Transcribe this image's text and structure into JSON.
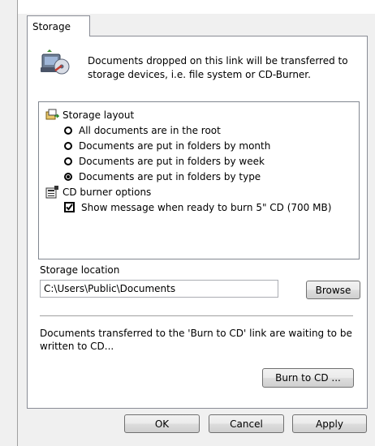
{
  "tab": {
    "label": "Storage"
  },
  "description": "Documents dropped on this link will be transferred to storage devices, i.e. file system or CD-Burner.",
  "options": {
    "storage_layout": {
      "title": "Storage layout",
      "items": [
        {
          "label": "All documents are in the root",
          "selected": false
        },
        {
          "label": "Documents are put in folders by month",
          "selected": false
        },
        {
          "label": "Documents are put in folders by week",
          "selected": false
        },
        {
          "label": "Documents are put in folders by type",
          "selected": true
        }
      ]
    },
    "cd_burner": {
      "title": "CD burner options",
      "checkbox_label": "Show message when ready to burn 5\" CD (700 MB)",
      "checked": true
    }
  },
  "storage_location": {
    "label": "Storage location",
    "value": "C:\\Users\\Public\\Documents",
    "browse_label": "Browse"
  },
  "note": "Documents transferred to the 'Burn to CD' link are waiting to be written to CD...",
  "burn_label": "Burn to CD ...",
  "footer": {
    "ok": "OK",
    "cancel": "Cancel",
    "apply": "Apply"
  }
}
